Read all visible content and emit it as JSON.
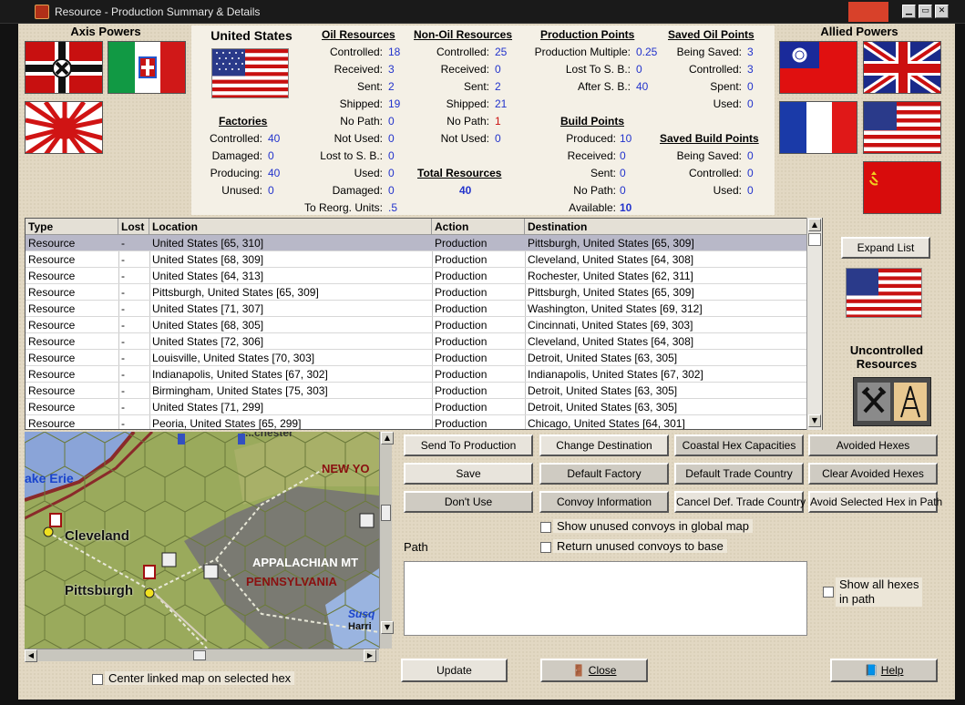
{
  "window": {
    "title": "Resource - Production Summary & Details"
  },
  "axis": {
    "title": "Axis Powers",
    "flags": [
      "germany-flag",
      "italy-flag",
      "japan-flag"
    ]
  },
  "allied": {
    "title": "Allied Powers",
    "flags": [
      "china-flag",
      "uk-flag",
      "france-flag",
      "usa-flag",
      "ussr-flag"
    ]
  },
  "country": {
    "name": "United States"
  },
  "factories": {
    "header": "Factories",
    "rows": [
      [
        "Controlled:",
        "40"
      ],
      [
        "Damaged:",
        "0"
      ],
      [
        "Producing:",
        "40"
      ],
      [
        "Unused:",
        "0"
      ]
    ]
  },
  "oil": {
    "header": "Oil Resources",
    "rows": [
      [
        "Controlled:",
        "18"
      ],
      [
        "Received:",
        "3"
      ],
      [
        "Sent:",
        "2"
      ],
      [
        "Shipped:",
        "19"
      ],
      [
        "No Path:",
        "0"
      ],
      [
        "Not Used:",
        "0"
      ],
      [
        "Lost to S. B.:",
        "0"
      ],
      [
        "Used:",
        "0"
      ],
      [
        "Damaged:",
        "0"
      ],
      [
        "To Reorg. Units:",
        ".5"
      ]
    ]
  },
  "nonoil": {
    "header": "Non-Oil Resources",
    "rows": [
      [
        "Controlled:",
        "25"
      ],
      [
        "Received:",
        "0"
      ],
      [
        "Sent:",
        "2"
      ],
      [
        "Shipped:",
        "21"
      ],
      [
        "No Path:",
        "1"
      ],
      [
        "Not Used:",
        "0"
      ]
    ]
  },
  "total": {
    "header": "Total Resources",
    "value": "40"
  },
  "prodpoints": {
    "header": "Production Points",
    "rows": [
      [
        "Production Multiple:",
        "0.25"
      ],
      [
        "Lost To S. B.:",
        "0"
      ],
      [
        "After S. B.:",
        "40"
      ]
    ]
  },
  "buildpoints": {
    "header": "Build Points",
    "rows": [
      [
        "Produced:",
        "10"
      ],
      [
        "Received:",
        "0"
      ],
      [
        "Sent:",
        "0"
      ],
      [
        "No Path:",
        "0"
      ],
      [
        "Available:",
        "10"
      ]
    ]
  },
  "savedoil": {
    "header": "Saved Oil Points",
    "rows": [
      [
        "Being Saved:",
        "3"
      ],
      [
        "Controlled:",
        "3"
      ],
      [
        "Spent:",
        "0"
      ],
      [
        "Used:",
        "0"
      ]
    ]
  },
  "savedbuild": {
    "header": "Saved Build Points",
    "rows": [
      [
        "Being Saved:",
        "0"
      ],
      [
        "Controlled:",
        "0"
      ],
      [
        "Used:",
        "0"
      ]
    ]
  },
  "table": {
    "headers": [
      "Type",
      "Lost",
      "Location",
      "Action",
      "Destination"
    ],
    "rows": [
      [
        "Resource",
        "-",
        "United States [65, 310]",
        "Production",
        "Pittsburgh, United States [65, 309]"
      ],
      [
        "Resource",
        "-",
        "United States [68, 309]",
        "Production",
        "Cleveland, United States [64, 308]"
      ],
      [
        "Resource",
        "-",
        "United States [64, 313]",
        "Production",
        "Rochester, United States [62, 311]"
      ],
      [
        "Resource",
        "-",
        "Pittsburgh, United States [65, 309]",
        "Production",
        "Pittsburgh, United States [65, 309]"
      ],
      [
        "Resource",
        "-",
        "United States [71, 307]",
        "Production",
        "Washington, United States [69, 312]"
      ],
      [
        "Resource",
        "-",
        "United States [68, 305]",
        "Production",
        "Cincinnati, United States [69, 303]"
      ],
      [
        "Resource",
        "-",
        "United States [72, 306]",
        "Production",
        "Cleveland, United States [64, 308]"
      ],
      [
        "Resource",
        "-",
        "Louisville, United States [70, 303]",
        "Production",
        "Detroit, United States [63, 305]"
      ],
      [
        "Resource",
        "-",
        "Indianapolis, United States [67, 302]",
        "Production",
        "Indianapolis, United States [67, 302]"
      ],
      [
        "Resource",
        "-",
        "Birmingham, United States [75, 303]",
        "Production",
        "Detroit, United States [63, 305]"
      ],
      [
        "Resource",
        "-",
        "United States [71, 299]",
        "Production",
        "Detroit, United States [63, 305]"
      ],
      [
        "Resource",
        "-",
        "Peoria, United States [65, 299]",
        "Production",
        "Chicago, United States [64, 301]"
      ]
    ]
  },
  "side": {
    "expand": "Expand List",
    "uncontrolled_line1": "Uncontrolled",
    "uncontrolled_line2": "Resources"
  },
  "map": {
    "lake": "ake Erie",
    "city1": "Cleveland",
    "city2": "Pittsburgh",
    "region1": "NEW YO",
    "region2": "APPALACHIAN MT",
    "region3": "PENNSYLVANIA",
    "river": "Susq",
    "town": "Harri",
    "top_text": "...chester"
  },
  "buttons": {
    "send": "Send To Production",
    "change": "Change Destination",
    "coastal": "Coastal Hex Capacities",
    "avoided": "Avoided Hexes",
    "save": "Save",
    "deffactory": "Default Factory",
    "deftrade": "Default Trade Country",
    "clearavoided": "Clear Avoided Hexes",
    "dontuse": "Don't Use",
    "convoyinfo": "Convoy Information",
    "canceltrade": "Cancel Def. Trade Country",
    "avoidsel": "Avoid Selected Hex in Path",
    "update": "Update",
    "close": "Close",
    "help": "Help"
  },
  "checks": {
    "unused_global": "Show unused convoys in global map",
    "return_unused": "Return unused convoys to base",
    "show_all_1": "Show all hexes",
    "show_all_2": "in path",
    "center_map": "Center linked map on selected hex"
  },
  "path": {
    "label": "Path"
  },
  "colors": {
    "panel": "#e2d8c3",
    "value_blue": "#2233cc",
    "value_red": "#cc1111",
    "selected_row": "#b8b8c8"
  }
}
